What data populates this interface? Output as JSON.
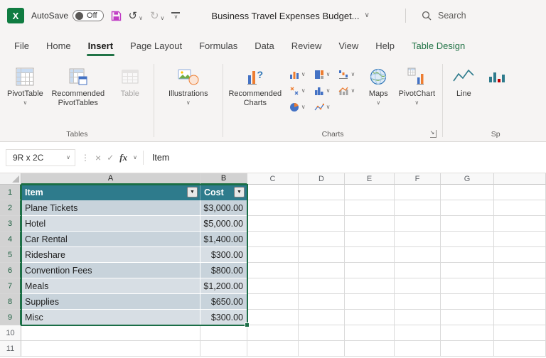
{
  "titlebar": {
    "autosave_label": "AutoSave",
    "autosave_state": "Off",
    "document_title": "Business Travel Expenses Budget...",
    "search_label": "Search"
  },
  "tabs": [
    {
      "label": "File",
      "active": false,
      "contextual": false
    },
    {
      "label": "Home",
      "active": false,
      "contextual": false
    },
    {
      "label": "Insert",
      "active": true,
      "contextual": false
    },
    {
      "label": "Page Layout",
      "active": false,
      "contextual": false
    },
    {
      "label": "Formulas",
      "active": false,
      "contextual": false
    },
    {
      "label": "Data",
      "active": false,
      "contextual": false
    },
    {
      "label": "Review",
      "active": false,
      "contextual": false
    },
    {
      "label": "View",
      "active": false,
      "contextual": false
    },
    {
      "label": "Help",
      "active": false,
      "contextual": false
    },
    {
      "label": "Table Design",
      "active": false,
      "contextual": true
    }
  ],
  "ribbon": {
    "pivottable_label": "PivotTable",
    "recommended_pivottables_label": "Recommended PivotTables",
    "table_label": "Table",
    "illustrations_label": "Illustrations",
    "recommended_charts_label": "Recommended Charts",
    "maps_label": "Maps",
    "pivotchart_label": "PivotChart",
    "line_label": "Line",
    "tables_group_label": "Tables",
    "charts_group_label": "Charts",
    "sparklines_group_label": "Sp",
    "chart_gallery_icons": [
      "column-bar-chart-icon",
      "hierarchy-chart-icon",
      "waterfall-chart-icon",
      "scatter-chart-icon",
      "statistic-chart-icon",
      "combo-chart-icon",
      "pie-chart-icon",
      "line-chart-icon"
    ]
  },
  "formula_bar": {
    "name_box": "9R x 2C",
    "fx_label": "fx",
    "content": "Item"
  },
  "sheet": {
    "column_headers": [
      "A",
      "B",
      "C",
      "D",
      "E",
      "F",
      "G"
    ],
    "row_headers": [
      "1",
      "2",
      "3",
      "4",
      "5",
      "6",
      "7",
      "8",
      "9",
      "10",
      "11"
    ],
    "selected_columns": [
      "A",
      "B"
    ],
    "selected_rows": [
      "1",
      "2",
      "3",
      "4",
      "5",
      "6",
      "7",
      "8",
      "9"
    ],
    "table": {
      "headers": [
        "Item",
        "Cost"
      ],
      "rows": [
        {
          "item": "Plane Tickets",
          "cost": "$3,000.00"
        },
        {
          "item": "Hotel",
          "cost": "$5,000.00"
        },
        {
          "item": "Car Rental",
          "cost": "$1,400.00"
        },
        {
          "item": "Rideshare",
          "cost": "$300.00"
        },
        {
          "item": "Convention Fees",
          "cost": "$800.00"
        },
        {
          "item": "Meals",
          "cost": "$1,200.00"
        },
        {
          "item": "Supplies",
          "cost": "$650.00"
        },
        {
          "item": "Misc",
          "cost": "$300.00"
        }
      ]
    }
  },
  "icons": {
    "app_letter": "X",
    "chevron_down": "∨",
    "undo": "↺",
    "redo": "↻",
    "ellipsis_vertical": "⋮",
    "cancel": "×",
    "accept": "✓",
    "filter_dropdown": "▼",
    "dialog_launcher": "↘"
  },
  "colors": {
    "excel_green": "#217346",
    "table_header_fill": "#2E7B8C",
    "band_dark": "#C8D3DB",
    "band_light": "#D7DEE4",
    "selection_border": "#1B6E47",
    "save_icon": "#C03BC4"
  }
}
